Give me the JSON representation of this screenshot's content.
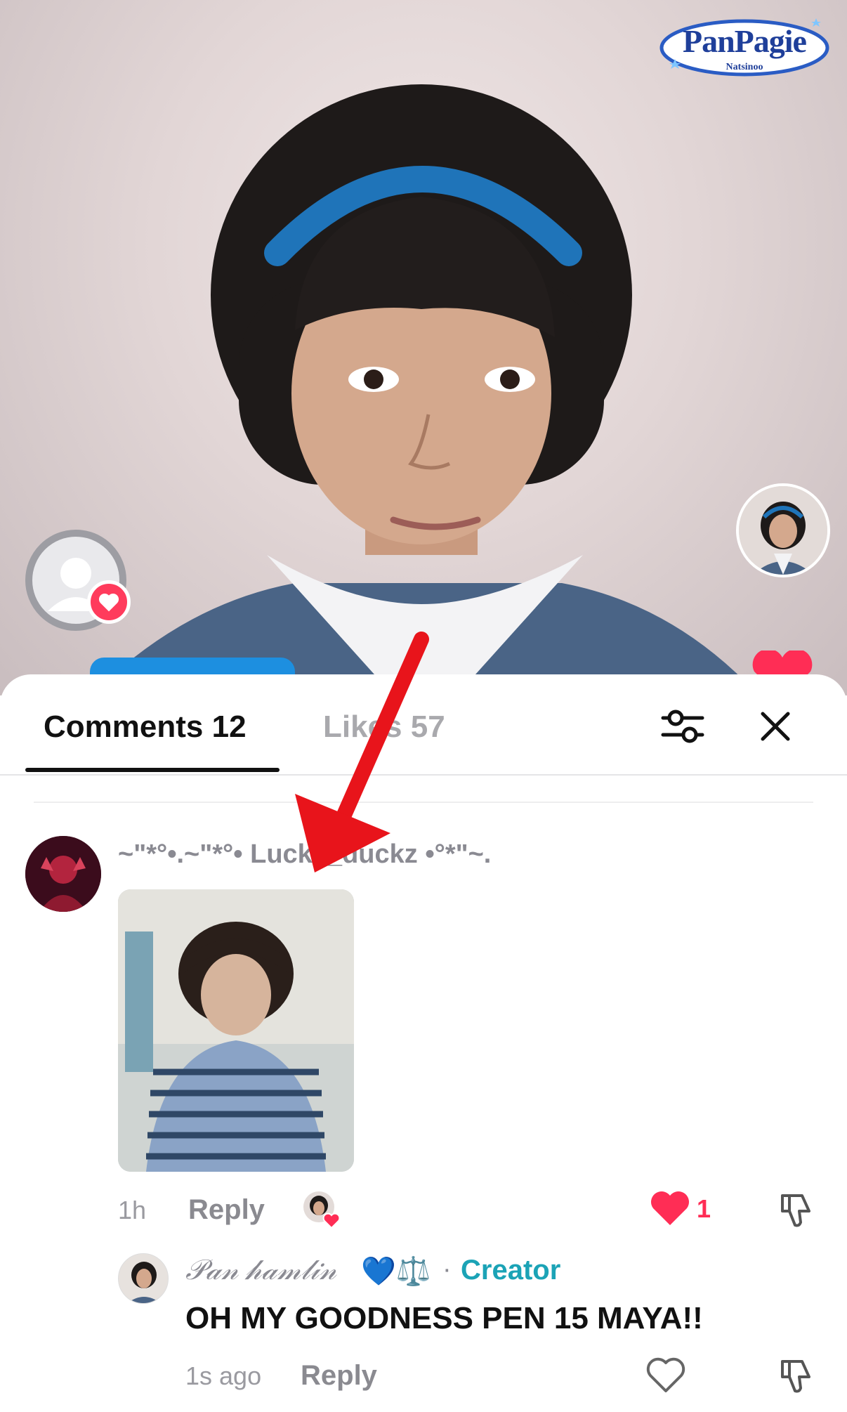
{
  "watermark": {
    "title": "PanPagie",
    "subtitle": "Natsinoo"
  },
  "tabs": {
    "comments_label": "Comments 12",
    "likes_label": "Likes 57"
  },
  "comments": [
    {
      "author": "~\"*°•.~\"*°• Lucky_duckz •°*\"~.",
      "time": "1h",
      "reply_label": "Reply",
      "like_count": "1",
      "has_image": true
    },
    {
      "author": "𝒫𝒶𝓃 𝒽𝒶𝓂𝓁𝒾𝓃",
      "author_emojis": "💙⚖️",
      "badge": "Creator",
      "text": "OH MY GOODNESS PEN 15 MAYA!!",
      "time": "1s ago",
      "reply_label": "Reply"
    }
  ],
  "colors": {
    "like_red": "#ff2d55",
    "creator_teal": "#1ba3b6",
    "tab_active": "#111111",
    "tab_inactive": "#a9a9ad",
    "annotation_arrow": "#e8141b"
  },
  "icons": {
    "filter": "sliders-icon",
    "close": "close-icon",
    "like": "heart-icon",
    "dislike": "thumbs-down-icon"
  }
}
